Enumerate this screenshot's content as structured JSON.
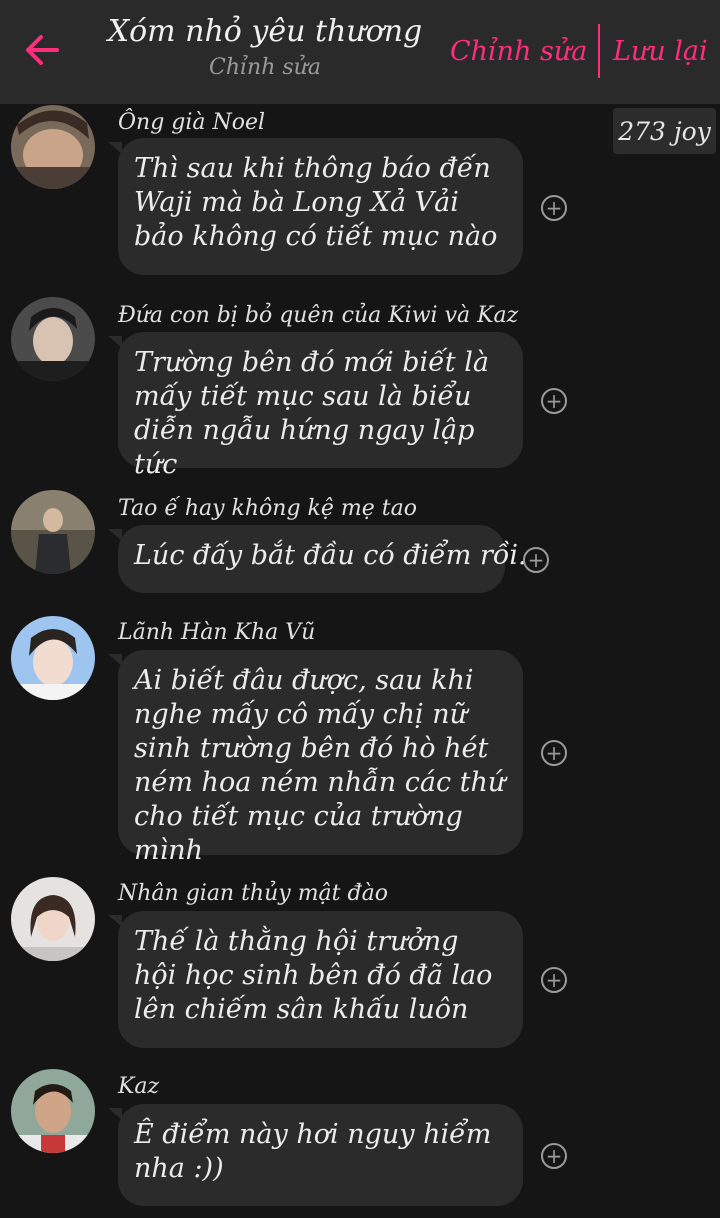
{
  "header": {
    "title": "Xóm nhỏ yêu thương",
    "subtitle": "Chỉnh sửa",
    "edit_label": "Chỉnh sửa",
    "save_label": "Lưu lại",
    "accent_color": "#ff2d7a"
  },
  "badge": {
    "text": "273 joy"
  },
  "messages": [
    {
      "sender": "Ông già Noel",
      "text": "Thì sau khi thông báo đến Waji mà bà Long Xả Vải bảo không có tiết mục nào"
    },
    {
      "sender": "Đứa con bị bỏ quên của Kiwi và Kaz",
      "text": "Trường bên đó mới biết là mấy tiết mục sau là biểu diễn ngẫu hứng ngay lập tức"
    },
    {
      "sender": "Tao ế hay không kệ mẹ tao",
      "text": "Lúc đấy bắt đầu có điểm rồi."
    },
    {
      "sender": "Lãnh Hàn Kha Vũ",
      "text": "Ai biết đâu được, sau khi nghe mấy cô mấy chị nữ sinh trường bên đó hò hét ném hoa ném nhẫn các thứ cho tiết mục của trường mình"
    },
    {
      "sender": "Nhân gian thủy mật đào",
      "text": "Thế là thằng hội trưởng hội học sinh bên đó đã lao lên chiếm sân khấu luôn"
    },
    {
      "sender": "Kaz",
      "text": "Ê điểm này hơi nguy hiểm nha :))"
    }
  ]
}
